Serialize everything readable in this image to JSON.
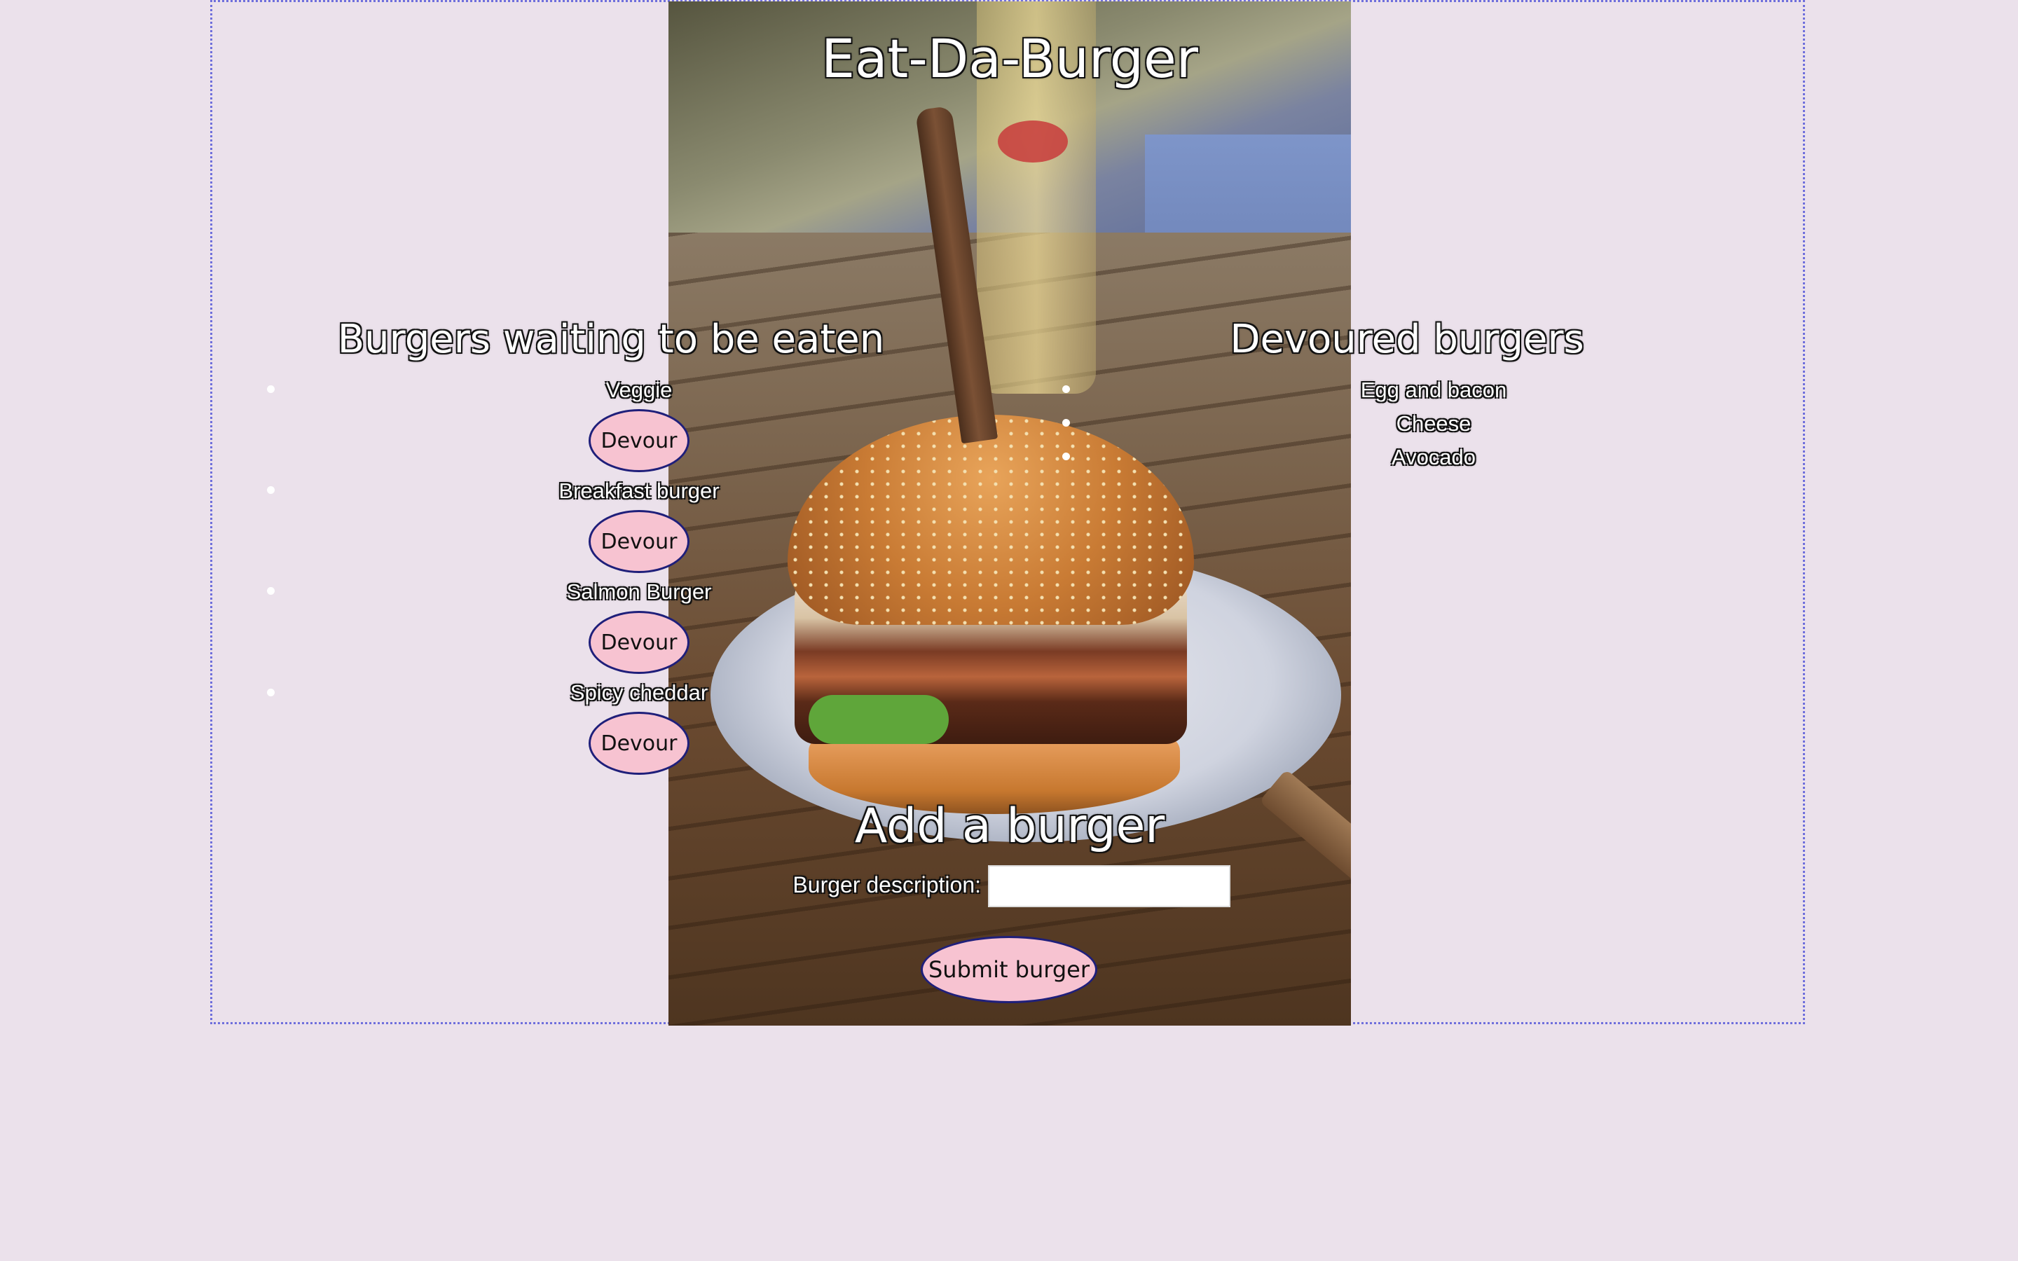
{
  "header": {
    "title": "Eat-Da-Burger"
  },
  "waiting": {
    "title": "Burgers waiting to be eaten",
    "items": [
      {
        "name": "Veggie",
        "button_label": "Devour"
      },
      {
        "name": "Breakfast burger",
        "button_label": "Devour"
      },
      {
        "name": "Salmon Burger",
        "button_label": "Devour"
      },
      {
        "name": "Spicy cheddar",
        "button_label": "Devour"
      }
    ]
  },
  "devoured": {
    "title": "Devoured burgers",
    "items": [
      "Egg and bacon",
      "Cheese",
      "Avocado"
    ]
  },
  "add_form": {
    "title": "Add a burger",
    "description_label": "Burger description:",
    "description_value": "",
    "description_placeholder": "",
    "submit_label": "Submit burger"
  },
  "colors": {
    "page_background": "#ebe1eb",
    "frame_border": "#6f6fdc",
    "button_fill": "#f7c3d1",
    "button_border": "#1f1f7a"
  }
}
